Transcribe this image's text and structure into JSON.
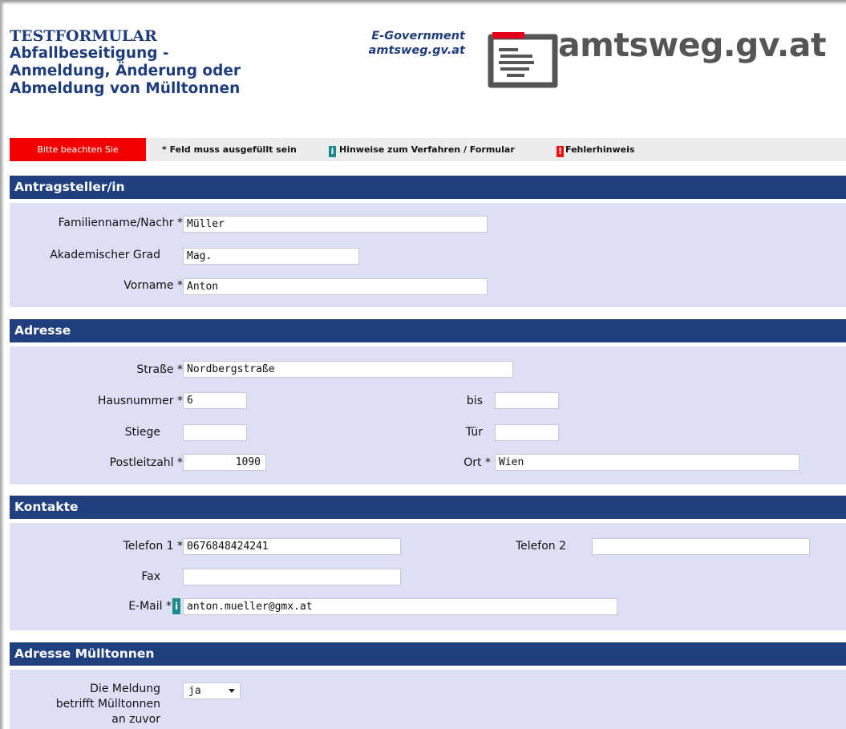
{
  "header": {
    "title_line1": "TESTFORMULAR",
    "title_line2": "Abfallbeseitigung -",
    "title_line3": "Anmeldung, Änderung oder",
    "title_line4": "Abmeldung von Mülltonnen",
    "egov_line1": "E-Government",
    "egov_line2": "amtsweg.gv.at",
    "logo_text": "amtsweg.gv.at"
  },
  "legend": {
    "attention": "Bitte beachten Sie",
    "required": "* Feld muss ausgefüllt sein",
    "info_badge": "i",
    "info": "Hinweise zum Verfahren / Formular",
    "error_badge": "!",
    "error": "Fehlerhinweis"
  },
  "applicant": {
    "heading": "Antragsteller/in",
    "lastname_label": "Familienname/Nachr *",
    "lastname_value": "Müller",
    "degree_label": "Akademischer Grad",
    "degree_value": "Mag.",
    "firstname_label": "Vorname *",
    "firstname_value": "Anton"
  },
  "address": {
    "heading": "Adresse",
    "street_label": "Straße *",
    "street_value": "Nordbergstraße",
    "housenr_label": "Hausnummer *",
    "housenr_value": "6",
    "bis_label": "bis",
    "bis_value": "",
    "stair_label": "Stiege",
    "stair_value": "",
    "door_label": "Tür",
    "door_value": "",
    "zip_label": "Postleitzahl *",
    "zip_value": "1090",
    "city_label": "Ort *",
    "city_value": "Wien"
  },
  "contact": {
    "heading": "Kontakte",
    "phone1_label": "Telefon 1 *",
    "phone1_value": "0676848424241",
    "phone2_label": "Telefon 2",
    "phone2_value": "",
    "fax_label": "Fax",
    "fax_value": "",
    "email_label": "E-Mail *",
    "email_info": "i",
    "email_value": "anton.mueller@gmx.at"
  },
  "bins": {
    "heading": "Adresse Mülltonnen",
    "question_line1": "Die Meldung",
    "question_line2": "betrifft Mülltonnen",
    "question_line3": "an zuvor",
    "answer": "ja"
  }
}
